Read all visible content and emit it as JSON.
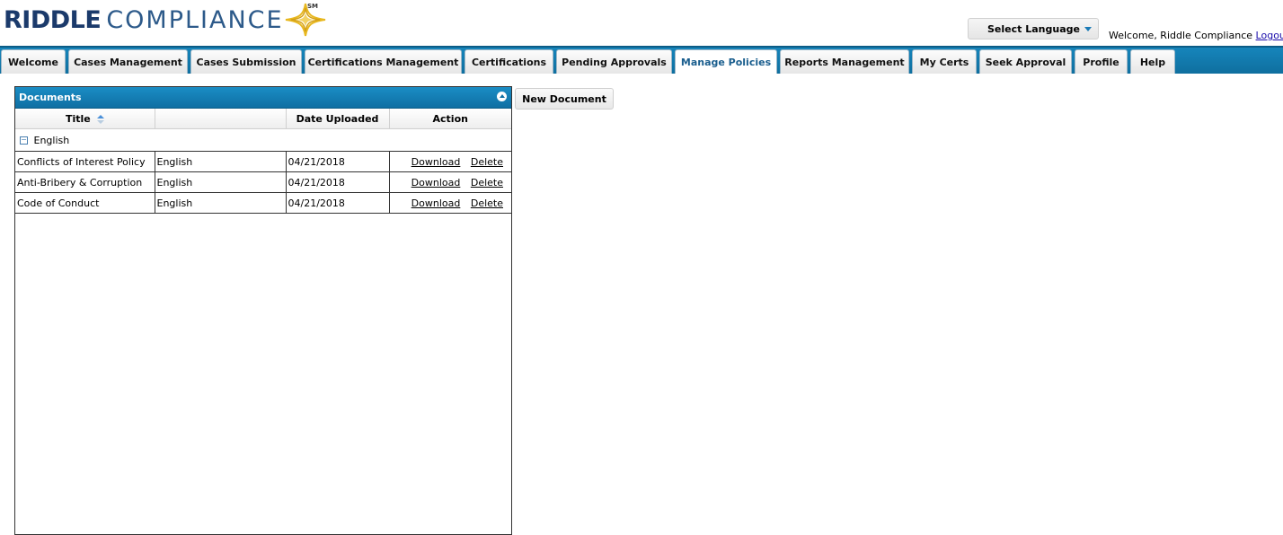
{
  "brand": {
    "bold": "RIDDLE",
    "light": "COMPLIANCE",
    "sm": "SM"
  },
  "header": {
    "language_label": "Select Language",
    "welcome_text": "Welcome, Riddle Compliance",
    "logout_label": "Logout"
  },
  "nav": {
    "tabs": [
      {
        "label": "Welcome"
      },
      {
        "label": "Cases Management"
      },
      {
        "label": "Cases Submission"
      },
      {
        "label": "Certifications Management"
      },
      {
        "label": "Certifications"
      },
      {
        "label": "Pending Approvals"
      },
      {
        "label": "Manage Policies",
        "active": true
      },
      {
        "label": "Reports Management"
      },
      {
        "label": "My Certs"
      },
      {
        "label": "Seek Approval"
      },
      {
        "label": "Profile"
      },
      {
        "label": "Help"
      }
    ]
  },
  "documents": {
    "panel_title": "Documents",
    "columns": {
      "title": "Title",
      "language": "",
      "date": "Date Uploaded",
      "action": "Action"
    },
    "group_label": "English",
    "rows": [
      {
        "title": "Conflicts of Interest Policy",
        "language": "English",
        "date": "04/21/2018",
        "download": "Download",
        "delete": "Delete"
      },
      {
        "title": "Anti-Bribery & Corruption",
        "language": "English",
        "date": "04/21/2018",
        "download": "Download",
        "delete": "Delete"
      },
      {
        "title": "Code of Conduct",
        "language": "English",
        "date": "04/21/2018",
        "download": "Download",
        "delete": "Delete"
      }
    ]
  },
  "new_document_label": "New Document",
  "colors": {
    "accent": "#1685bb",
    "brand_navy": "#1b3a6b",
    "star_gold": "#e8b81f"
  }
}
